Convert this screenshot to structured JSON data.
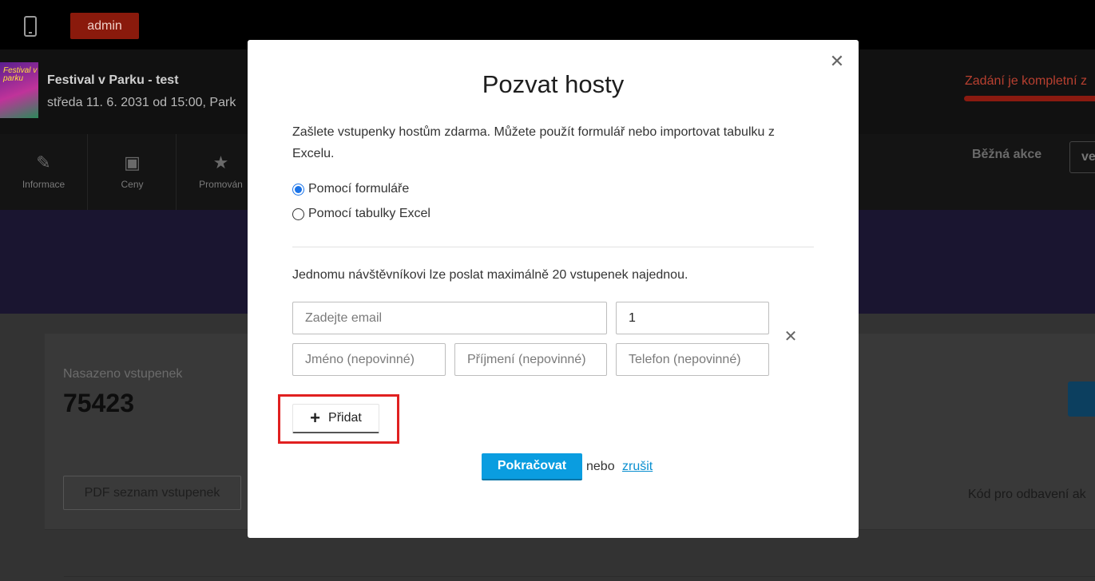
{
  "topbar": {
    "phone_icon": "mobile-phone-icon",
    "admin_label": "admin"
  },
  "event": {
    "thumbnail_text": "Festival v parku",
    "title": "Festival v Parku - test",
    "subtitle": "středa 11. 6. 2031 od 15:00, Park",
    "completion_text": "Zadání je kompletní z",
    "completion_color": "#b84030"
  },
  "tabs": [
    {
      "label": "Informace",
      "icon": "pencil-icon"
    },
    {
      "label": "Ceny",
      "icon": "wallet-icon"
    },
    {
      "label": "Promován",
      "icon": "star-icon"
    }
  ],
  "event_type": {
    "label": "Běžná akce",
    "select_value": "ve"
  },
  "stats": {
    "sold_label": "Nasazeno vstupenek",
    "sold_count": "75423"
  },
  "actions": {
    "pdf_label": "PDF seznam vstupenek",
    "redeem_code_label": "Kód pro odbavení ak"
  },
  "modal": {
    "title": "Pozvat hosty",
    "intro": "Zašlete vstupenky hostům zdarma. Můžete použít formulář nebo importovat tabulku z Excelu.",
    "options": [
      {
        "label": "Pomocí formuláře",
        "checked": true
      },
      {
        "label": "Pomocí tabulky Excel",
        "checked": false
      }
    ],
    "max_note": "Jednomu návštěvníkovi lze poslat maximálně 20 vstupenek najednou.",
    "form": {
      "email_placeholder": "Zadejte email",
      "quantity_value": "1",
      "first_name_placeholder": "Jméno (nepovinné)",
      "last_name_placeholder": "Příjmení (nepovinné)",
      "phone_placeholder": "Telefon (nepovinné)"
    },
    "add_label": "Přidat",
    "continue_label": "Pokračovat",
    "or_text": "nebo",
    "cancel_label": "zrušit",
    "accent_color": "#0a9de0",
    "highlight_color": "#e02020"
  }
}
